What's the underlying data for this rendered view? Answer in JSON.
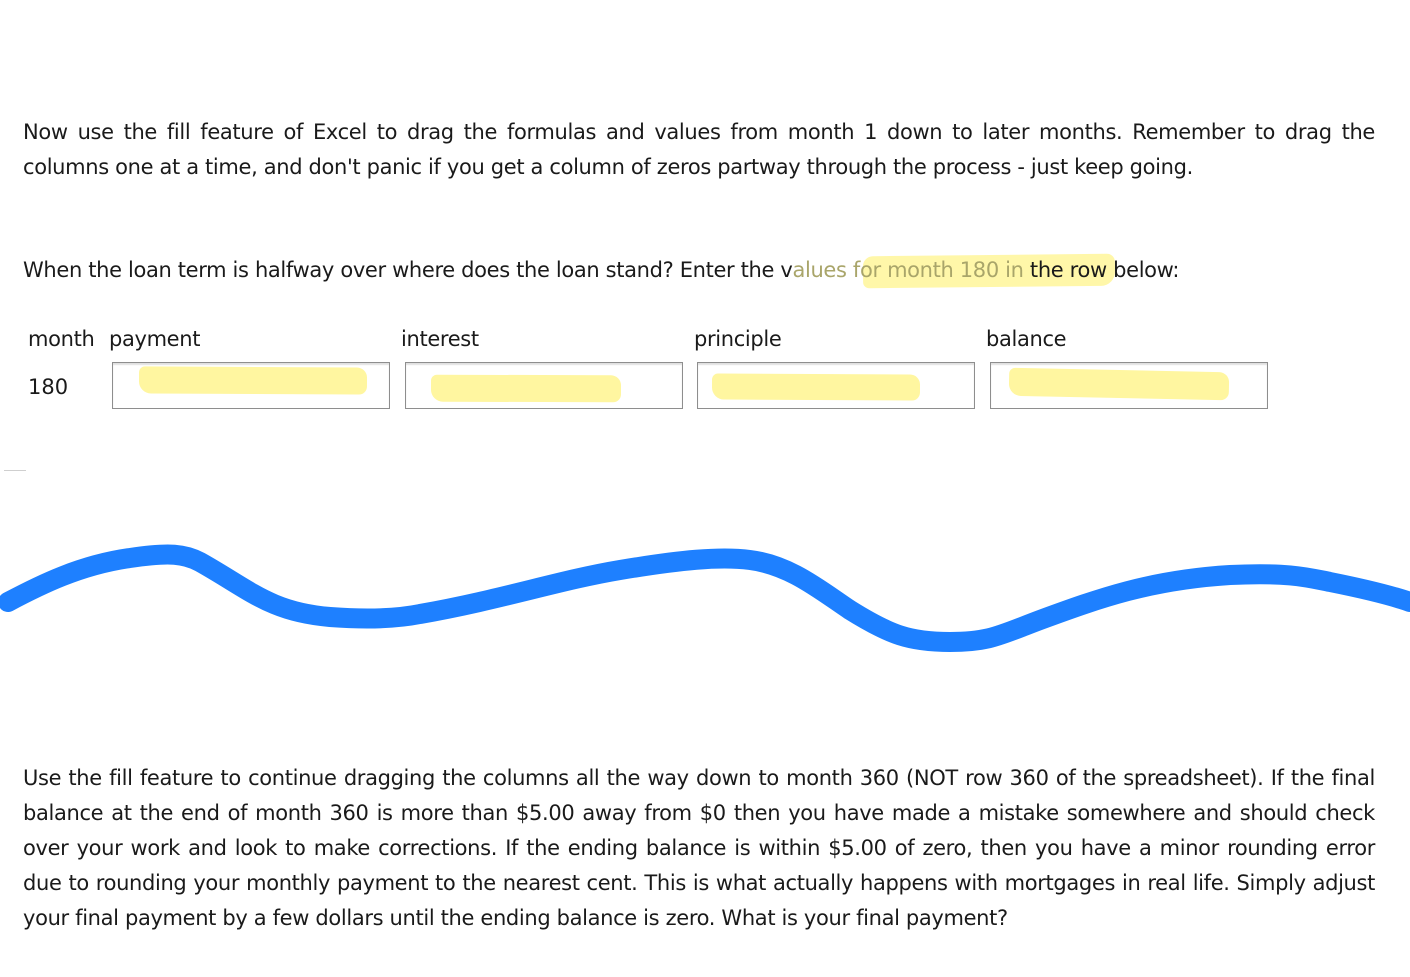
{
  "instructions": {
    "paragraph1": "Now use the fill feature of Excel to drag the formulas and values from month 1 down to later months.  Remember to drag the columns one at a time, and don't panic if you get a column of zeros partway through the process - just keep going.",
    "paragraph2_before": "When the loan term is halfway over where does the loan stand? Enter the v",
    "paragraph2_highlight": "alues for month 180 in",
    "paragraph2_after": " the row below:",
    "paragraph3": "Use the fill feature to continue dragging the columns all the way down to month 360 (NOT row 360 of the spreadsheet). If the final balance at the end of month 360 is more than $5.00 away from $0 then you have made a mistake somewhere and should check over your work and look to make corrections.  If the ending balance is within $5.00 of zero, then you have a minor rounding error due to rounding your monthly payment to the nearest cent.  This is what actually happens with mortgages in real life.  Simply adjust your final payment by a few dollars until the ending balance is zero.  What is your final payment?"
  },
  "answer_row": {
    "headers": {
      "month": "month",
      "payment": "payment",
      "interest": "interest",
      "principle": "principle",
      "balance": "balance"
    },
    "month_value": "180",
    "inputs": {
      "payment": "",
      "interest": "",
      "principle": "",
      "balance": ""
    }
  },
  "annotations": {
    "highlight_color": "#fff6a0",
    "scribble_color": "#1e80ff"
  }
}
